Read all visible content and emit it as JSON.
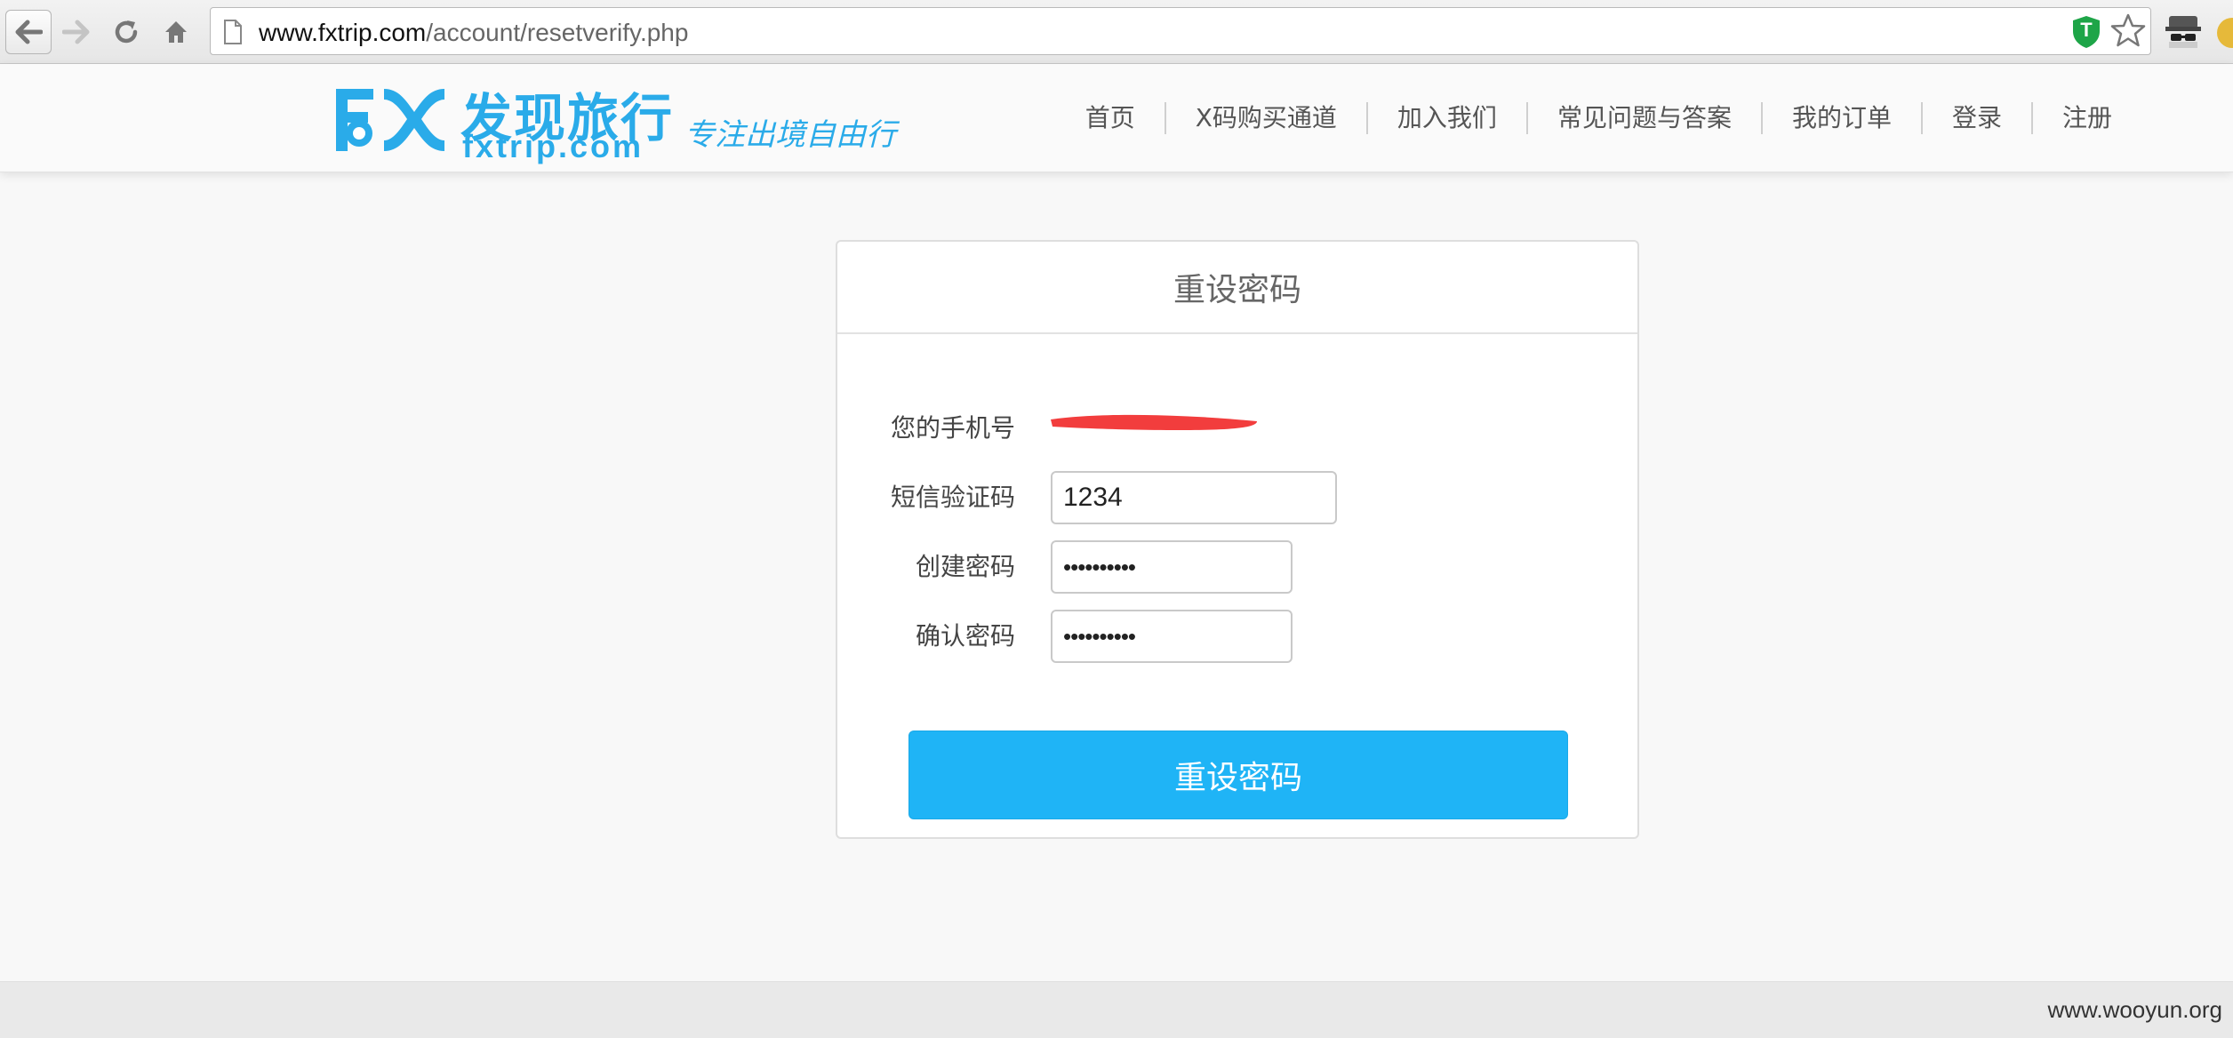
{
  "browser": {
    "url_host": "www.fxtrip.com",
    "url_path": "/account/resetverify.php",
    "extension_shield_letter": "T"
  },
  "site": {
    "logo_cn": "发现旅行",
    "logo_en": "fxtrip.com",
    "slogan": "专注出境自由行",
    "brand_color": "#2aabe9"
  },
  "nav": {
    "items": [
      {
        "label": "首页"
      },
      {
        "label": "X码购买通道"
      },
      {
        "label": "加入我们"
      },
      {
        "label": "常见问题与答案"
      },
      {
        "label": "我的订单"
      },
      {
        "label": "登录"
      },
      {
        "label": "注册"
      }
    ]
  },
  "form": {
    "title": "重设密码",
    "phone_label": "您的手机号",
    "sms_label": "短信验证码",
    "sms_value": "1234",
    "new_password_label": "创建密码",
    "new_password_value": "••••••••••",
    "confirm_password_label": "确认密码",
    "confirm_password_value": "••••••••••",
    "submit_label": "重设密码",
    "button_color": "#1fb4f6"
  },
  "footer": {
    "watermark": "www.wooyun.org"
  }
}
